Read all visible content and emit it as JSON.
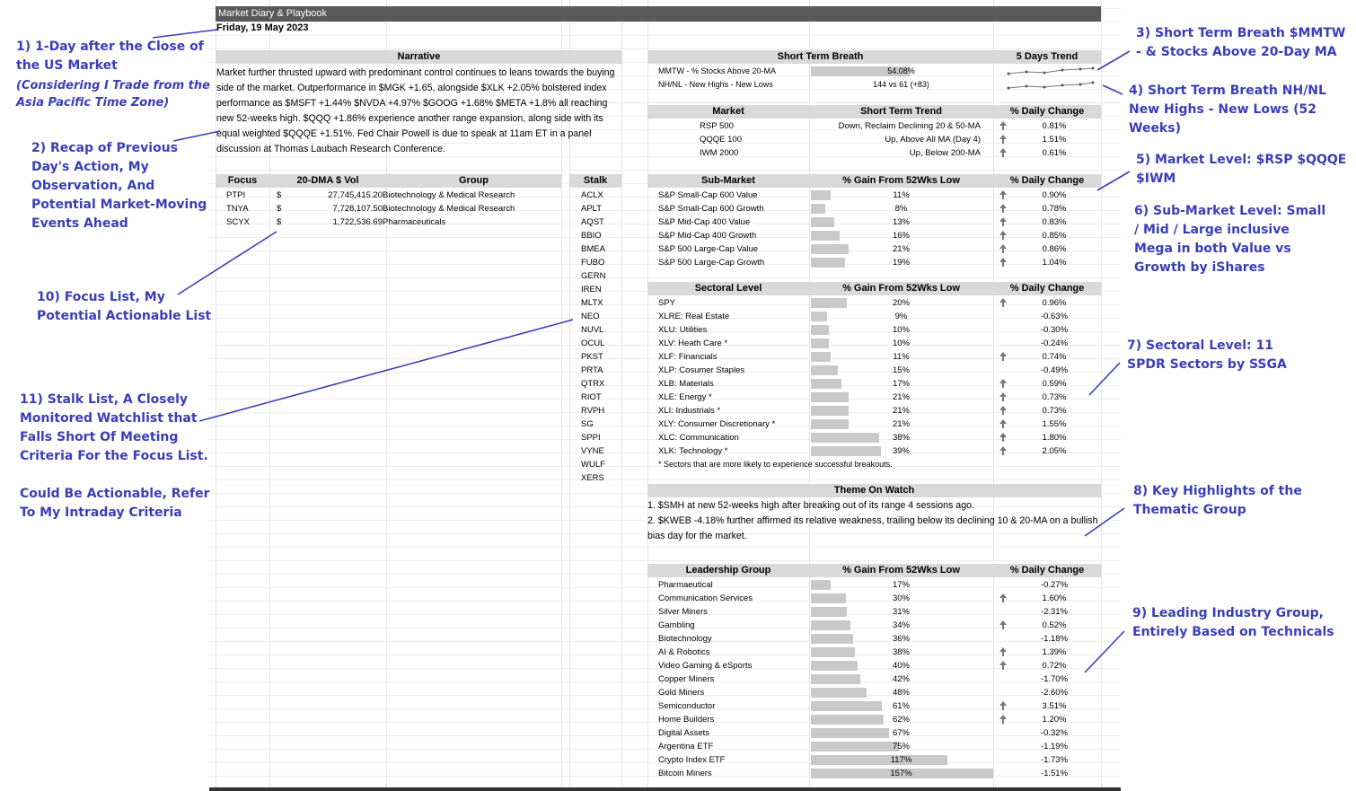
{
  "sheet": {
    "title": "Market Diary & Playbook",
    "date": "Friday, 19 May 2023"
  },
  "annotations": {
    "a1": "1) 1-Day after the Close of\nthe US Market",
    "a1sub": "(Considering I Trade from the\nAsia Pacific Time Zone)",
    "a2": "2) Recap of Previous\nDay's Action, My\nObservation, And\nPotential Market-Moving\nEvents Ahead",
    "a10": "10) Focus List, My\nPotential Actionable List",
    "a11": "11) Stalk List, A Closely\nMonitored Watchlist that\nFalls Short Of Meeting\nCriteria For the Focus List.\n\nCould Be Actionable, Refer\nTo My Intraday Criteria",
    "a3": "3) Short Term Breath $MMTW\n- & Stocks Above 20-Day MA",
    "a4": "4) Short Term Breath NH/NL\nNew Highs - New Lows (52 Weeks)",
    "a5": "5) Market Level: $RSP $QQQE $IWM",
    "a6": "6) Sub-Market Level: Small\n/ Mid / Large inclusive\nMega in both Value vs\nGrowth by iShares",
    "a7": "7) Sectoral Level: 11\nSPDR Sectors by SSGA",
    "a8": "8) Key Highlights of the\nThematic Group",
    "a9": "9) Leading Industry Group,\nEntirely Based on Technicals"
  },
  "narrative": {
    "header": "Narrative",
    "text": "Market further thrusted upward with predominant control continues to leans towards the buying side of the market. Outperformance in $MGK +1.65, alongside $XLK +2.05% bolstered index performance as $MSFT +1.44% $NVDA +4.97% $GOOG +1.68% $META +1.8% all reaching new 52-weeks high. $QQQ +1.86% experience another range expansion, along side with its equal weighted $QQQE +1.51%. Fed Chair Powell is due to speak at 11am ET in a panel discussion at Thomas Laubach Research Conference."
  },
  "focus": {
    "headers": [
      "Focus",
      "20-DMA $ Vol",
      "Group"
    ],
    "rows": [
      {
        "ticker": "PTPI",
        "cur": "$",
        "vol": "27,745,415.20",
        "group": "Biotechnology & Medical Research"
      },
      {
        "ticker": "TNYA",
        "cur": "$",
        "vol": "7,728,107.50",
        "group": "Biotechnology & Medical Research"
      },
      {
        "ticker": "SCYX",
        "cur": "$",
        "vol": "1,722,536.69",
        "group": "Pharmaceuticals"
      }
    ]
  },
  "stalk": {
    "header": "Stalk",
    "items": [
      "ACLX",
      "APLT",
      "AQST",
      "BBIO",
      "BMEA",
      "FUBO",
      "GERN",
      "IREN",
      "MLTX",
      "NEO",
      "NUVL",
      "OCUL",
      "PKST",
      "PRTA",
      "QTRX",
      "RIOT",
      "RVPH",
      "SG",
      "SPPI",
      "VYNE",
      "WULF",
      "XERS"
    ]
  },
  "breadth": {
    "header": "Short Term Breath",
    "trend_header": "5 Days Trend",
    "rows": [
      {
        "label": "MMTW - % Stocks Above 20-MA",
        "value": "54.08%",
        "fill": 0.54
      },
      {
        "label": "NH/NL - New Highs - New Lows",
        "value": "144 vs 61 (+83)",
        "fill": 0
      }
    ]
  },
  "market": {
    "headers": [
      "Market",
      "Short Term Trend",
      "% Daily Change"
    ],
    "rows": [
      {
        "name": "RSP 500",
        "trend": "Down, Reclaim Declining 20 & 50-MA",
        "up": true,
        "chg": "0.81%"
      },
      {
        "name": "QQQE 100",
        "trend": "Up, Above All MA (Day 4)",
        "up": true,
        "chg": "1.51%"
      },
      {
        "name": "IWM 2000",
        "trend": "Up, Below 200-MA",
        "up": true,
        "chg": "0.61%"
      }
    ]
  },
  "submarket": {
    "headers": [
      "Sub-Market",
      "% Gain From 52Wks Low",
      "% Daily Change"
    ],
    "rows": [
      {
        "name": "S&P Small-Cap 600 Value",
        "gain": "11%",
        "g": 11,
        "up": true,
        "chg": "0.90%"
      },
      {
        "name": "S&P Small-Cap 600 Growth",
        "gain": "8%",
        "g": 8,
        "up": true,
        "chg": "0.78%"
      },
      {
        "name": "S&P Mid-Cap 400 Value",
        "gain": "13%",
        "g": 13,
        "up": true,
        "chg": "0.83%"
      },
      {
        "name": "S&P Mid-Cap 400 Growth",
        "gain": "16%",
        "g": 16,
        "up": true,
        "chg": "0.85%"
      },
      {
        "name": "S&P 500 Large-Cap Value",
        "gain": "21%",
        "g": 21,
        "up": true,
        "chg": "0.86%"
      },
      {
        "name": "S&P 500 Large-Cap Growth",
        "gain": "19%",
        "g": 19,
        "up": true,
        "chg": "1.04%"
      }
    ]
  },
  "sector": {
    "headers": [
      "Sectoral Level",
      "% Gain From 52Wks Low",
      "% Daily Change"
    ],
    "note": "* Sectors that are more likely to experience successful breakouts.",
    "rows": [
      {
        "name": "SPY",
        "gain": "20%",
        "g": 20,
        "up": true,
        "chg": "0.96%"
      },
      {
        "name": "XLRE: Real Estate",
        "gain": "9%",
        "g": 9,
        "up": false,
        "chg": "-0.63%"
      },
      {
        "name": "XLU:  Utilities",
        "gain": "10%",
        "g": 10,
        "up": false,
        "chg": "-0.30%"
      },
      {
        "name": "XLV:  Heath Care *",
        "gain": "10%",
        "g": 10,
        "up": false,
        "chg": "-0.24%"
      },
      {
        "name": "XLF:  Financials",
        "gain": "11%",
        "g": 11,
        "up": true,
        "chg": "0.74%"
      },
      {
        "name": "XLP:  Cosumer Staples",
        "gain": "15%",
        "g": 15,
        "up": false,
        "chg": "-0.49%"
      },
      {
        "name": "XLB:  Materials",
        "gain": "17%",
        "g": 17,
        "up": true,
        "chg": "0.59%"
      },
      {
        "name": "XLE:  Energy *",
        "gain": "21%",
        "g": 21,
        "up": true,
        "chg": "0.73%"
      },
      {
        "name": "XLI:  Industrials *",
        "gain": "21%",
        "g": 21,
        "up": true,
        "chg": "0.73%"
      },
      {
        "name": "XLY:  Consumer Discretionary *",
        "gain": "21%",
        "g": 21,
        "up": true,
        "chg": "1.55%"
      },
      {
        "name": "XLC:  Communication",
        "gain": "38%",
        "g": 38,
        "up": true,
        "chg": "1.80%"
      },
      {
        "name": "XLK:  Technology *",
        "gain": "39%",
        "g": 39,
        "up": true,
        "chg": "2.05%"
      }
    ]
  },
  "theme": {
    "header": "Theme On Watch",
    "lines": [
      "1. $SMH at new 52-weeks high after breaking out of its range 4 sessions ago.",
      "2. $KWEB -4.18% further affirmed its relative weakness, trailing below its declining 10 & 20-MA on a bullish bias day for the market."
    ]
  },
  "leadership": {
    "headers": [
      "Leadership Group",
      "% Gain From 52Wks Low",
      "% Daily Change"
    ],
    "rows": [
      {
        "name": "Pharmaeutical",
        "gain": "17%",
        "g": 17,
        "up": false,
        "chg": "-0.27%"
      },
      {
        "name": "Communication Services",
        "gain": "30%",
        "g": 30,
        "up": true,
        "chg": "1.60%"
      },
      {
        "name": "Silver Miners",
        "gain": "31%",
        "g": 31,
        "up": false,
        "chg": "-2.31%"
      },
      {
        "name": "Gambling",
        "gain": "34%",
        "g": 34,
        "up": true,
        "chg": "0.52%"
      },
      {
        "name": "Biotechnology",
        "gain": "36%",
        "g": 36,
        "up": false,
        "chg": "-1.18%"
      },
      {
        "name": "AI & Robotics",
        "gain": "38%",
        "g": 38,
        "up": true,
        "chg": "1.39%"
      },
      {
        "name": "Video Gaming & eSports",
        "gain": "40%",
        "g": 40,
        "up": true,
        "chg": "0.72%"
      },
      {
        "name": "Copper Miners",
        "gain": "42%",
        "g": 42,
        "up": false,
        "chg": "-1.70%"
      },
      {
        "name": "Gold Miners",
        "gain": "48%",
        "g": 48,
        "up": false,
        "chg": "-2.60%"
      },
      {
        "name": "Semiconductor",
        "gain": "61%",
        "g": 61,
        "up": true,
        "chg": "3.51%"
      },
      {
        "name": "Home Builders",
        "gain": "62%",
        "g": 62,
        "up": true,
        "chg": "1.20%"
      },
      {
        "name": "Digital Assets",
        "gain": "67%",
        "g": 67,
        "up": false,
        "chg": "-0.32%"
      },
      {
        "name": "Argentina ETF",
        "gain": "75%",
        "g": 75,
        "up": false,
        "chg": "-1.19%"
      },
      {
        "name": "Crypto Index ETF",
        "gain": "117%",
        "g": 117,
        "up": false,
        "chg": "-1.73%"
      },
      {
        "name": "Bitcoin Miners",
        "gain": "157%",
        "g": 157,
        "up": false,
        "chg": "-1.51%"
      }
    ]
  },
  "colors": {
    "annotation": "#3a3eb8",
    "header_fill": "#d9d9d9",
    "title_fill": "#595959",
    "bar": "#c9c9c9"
  }
}
